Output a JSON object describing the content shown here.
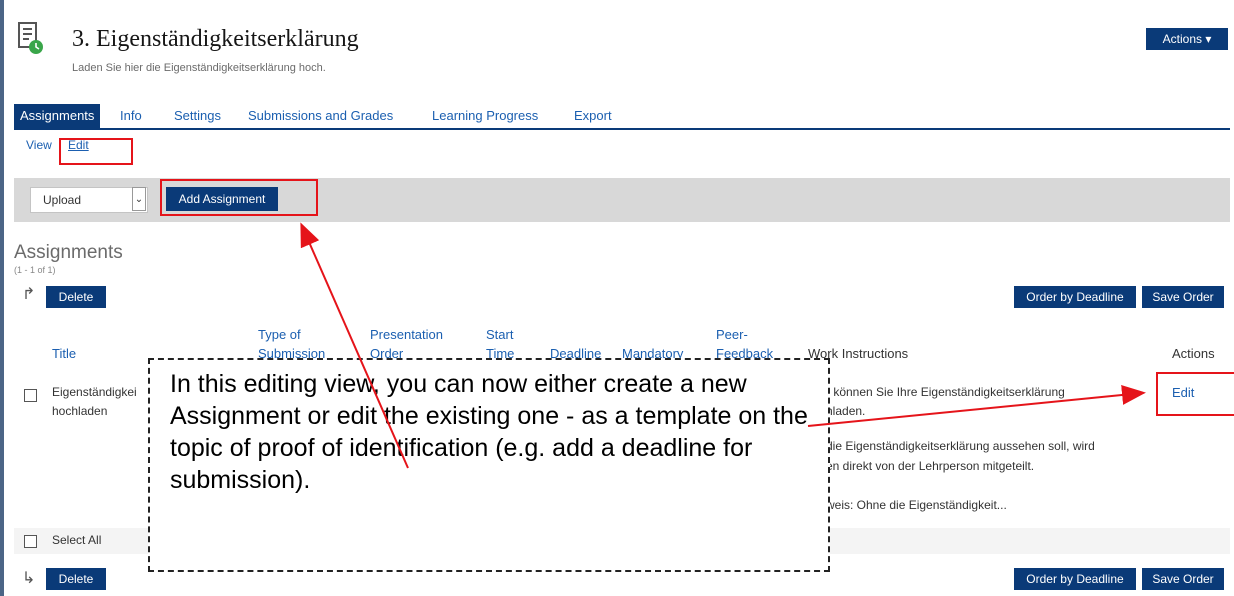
{
  "header": {
    "title": "3. Eigenständigkeitserklärung",
    "description": "Laden Sie hier die Eigenständigkeitserklärung hoch.",
    "actions_label": "Actions ▾"
  },
  "tabs": [
    {
      "label": "Assignments",
      "active": true
    },
    {
      "label": "Info",
      "active": false
    },
    {
      "label": "Settings",
      "active": false
    },
    {
      "label": "Submissions and Grades",
      "active": false
    },
    {
      "label": "Learning Progress",
      "active": false
    },
    {
      "label": "Export",
      "active": false
    }
  ],
  "subtabs": {
    "view": "View",
    "edit": "Edit"
  },
  "toolbar": {
    "select_value": "Upload",
    "add_label": "Add Assignment"
  },
  "section": {
    "title": "Assignments",
    "count": "(1 - 1 of 1)"
  },
  "list_actions": {
    "delete": "Delete",
    "order_by_deadline": "Order by Deadline",
    "save_order": "Save Order"
  },
  "table": {
    "headers": {
      "title": "Title",
      "type_of_submission": "Type of Submission",
      "presentation_order": "Presentation Order",
      "start_time": "Start Time",
      "deadline": "Deadline",
      "mandatory": "Mandatory",
      "peer_feedback": "Peer-Feedback",
      "work_instructions": "Work Instructions",
      "actions": "Actions"
    },
    "row": {
      "title_line1": "Eigenständigkei",
      "title_line2": "hochladen",
      "instr_line1": "r können Sie Ihre Eigenständigkeitserklärung",
      "instr_line2": "hladen.",
      "instr_line3": "die Eigenständigkeitserklärung aussehen soll, wird",
      "instr_line4": "en direkt von der Lehrperson mitgeteilt.",
      "instr_line5": "weis: Ohne die Eigenständigkeit...",
      "edit_label": "Edit"
    },
    "select_all": "Select All"
  },
  "callout": {
    "text": "In this editing view, you can now either create a new Assignment or edit the existing one - as a template on the topic of proof of identification (e.g. add a deadline for submission)."
  },
  "colors": {
    "brand": "#0a3a78",
    "link": "#1b5fb0",
    "annotation": "#e5141a"
  }
}
